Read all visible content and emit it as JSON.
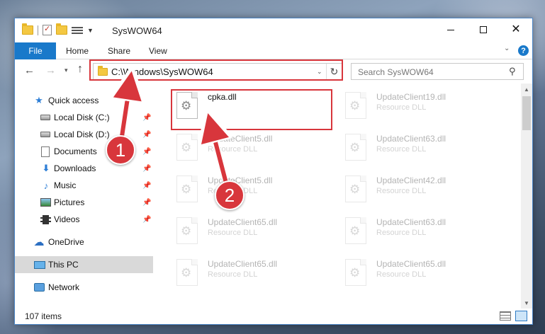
{
  "window": {
    "title": "SysWOW64",
    "controls": {
      "minimize": "minimize",
      "maximize": "maximize",
      "close": "✕"
    }
  },
  "ribbon": {
    "tabs": [
      "File",
      "Home",
      "Share",
      "View"
    ],
    "help": "?"
  },
  "navigation": {
    "back": "←",
    "forward": "→",
    "recent": "▾",
    "up": "↑",
    "address": "C:\\Windows\\SysWOW64",
    "address_dropdown": "⌄",
    "refresh": "↻"
  },
  "search": {
    "placeholder": "Search SysWOW64",
    "icon": "search-icon"
  },
  "sidebar": {
    "items": [
      {
        "label": "Quick access",
        "icon": "star-icon",
        "pinned": false
      },
      {
        "label": "Local Disk (C:)",
        "icon": "drive-icon",
        "pinned": true
      },
      {
        "label": "Local Disk (D:)",
        "icon": "drive-icon",
        "pinned": true
      },
      {
        "label": "Documents",
        "icon": "documents-icon",
        "pinned": true
      },
      {
        "label": "Downloads",
        "icon": "download-icon",
        "pinned": true
      },
      {
        "label": "Music",
        "icon": "music-icon",
        "pinned": true
      },
      {
        "label": "Pictures",
        "icon": "pictures-icon",
        "pinned": true
      },
      {
        "label": "Videos",
        "icon": "video-icon",
        "pinned": true
      },
      {
        "label": "OneDrive",
        "icon": "cloud-icon",
        "pinned": false
      },
      {
        "label": "This PC",
        "icon": "computer-icon",
        "pinned": false,
        "selected": true
      },
      {
        "label": "Network",
        "icon": "network-icon",
        "pinned": false
      }
    ]
  },
  "files": [
    {
      "name": "cpka.dll",
      "type": "",
      "faded": false
    },
    {
      "name": "UpdateClient19.dll",
      "type": "Resource DLL",
      "faded": true
    },
    {
      "name": "UpdateClient5.dll",
      "type": "Resource DLL",
      "faded": true
    },
    {
      "name": "UpdateClient63.dll",
      "type": "Resource DLL",
      "faded": true
    },
    {
      "name": "UpdateClient5.dll",
      "type": "Resource DLL",
      "faded": true
    },
    {
      "name": "UpdateClient42.dll",
      "type": "Resource DLL",
      "faded": true
    },
    {
      "name": "UpdateClient65.dll",
      "type": "Resource DLL",
      "faded": true
    },
    {
      "name": "UpdateClient63.dll",
      "type": "Resource DLL",
      "faded": true
    },
    {
      "name": "UpdateClient65.dll",
      "type": "Resource DLL",
      "faded": true
    },
    {
      "name": "UpdateClient65.dll",
      "type": "Resource DLL",
      "faded": true
    }
  ],
  "status": {
    "item_count": "107 items"
  },
  "annotations": {
    "step1": "1",
    "step2": "2",
    "highlight_color": "#d8363c"
  },
  "colors": {
    "accent": "#1979ca",
    "selection": "#d9d9d9"
  }
}
